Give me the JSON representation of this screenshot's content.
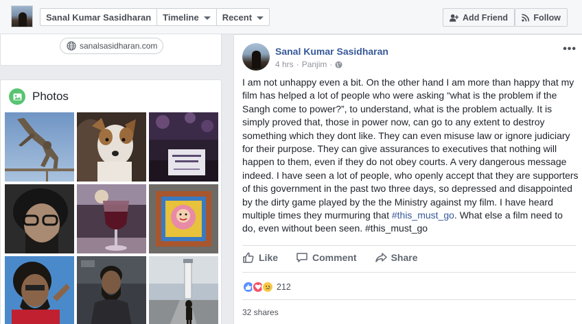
{
  "topbar": {
    "profile_name": "Sanal Kumar Sasidharan",
    "timeline_label": "Timeline",
    "recent_label": "Recent",
    "add_friend_label": "Add Friend",
    "follow_label": "Follow"
  },
  "intro": {
    "website": "sanalsasidharan.com"
  },
  "photos": {
    "title": "Photos",
    "items": [
      {
        "icon": "statue-photo"
      },
      {
        "icon": "dog-photo"
      },
      {
        "icon": "award-photo"
      },
      {
        "icon": "man-glasses-photo"
      },
      {
        "icon": "wine-glass-photo"
      },
      {
        "icon": "rangoli-photo"
      },
      {
        "icon": "man-sunglasses-photo"
      },
      {
        "icon": "man-beard-photo"
      },
      {
        "icon": "lighthouse-photo"
      }
    ]
  },
  "post": {
    "author": "Sanal Kumar Sasidharan",
    "time": "4 hrs",
    "separator": "·",
    "location": "Panjim",
    "privacy_icon": "globe-icon",
    "body_main": "I am not unhappy even a bit. On the other hand I am more than happy that my film has helped a lot of people who were asking “what is the problem if the Sangh come to power?”, to understand, what is the problem actually. It is simply proved that, those in power now, can go to any extent to destroy something which they dont like. They can even misuse law or ignore judiciary for their purpose. They can give assurances to executives that nothing will happen to them, even if they do not obey courts. A very dangerous message indeed. I have seen a lot of people, who openly accept that they are supporters of this government in the past two three days, so depressed and disappointed by the dirty game played by the the Ministry against my film. I have heard multiple times they murmuring that ",
    "hashtag1": "#this_must_go",
    "body_tail": ". What else a film need to do, even without been seen. #this_must_go",
    "actions": {
      "like": "Like",
      "comment": "Comment",
      "share": "Share"
    },
    "reaction_count": "212",
    "shares": "32 shares"
  },
  "colors": {
    "link": "#365899",
    "like_blue": "#5890ff",
    "love_red": "#f25268",
    "sad_yellow": "#f7c945",
    "photos_green": "#58c472"
  }
}
